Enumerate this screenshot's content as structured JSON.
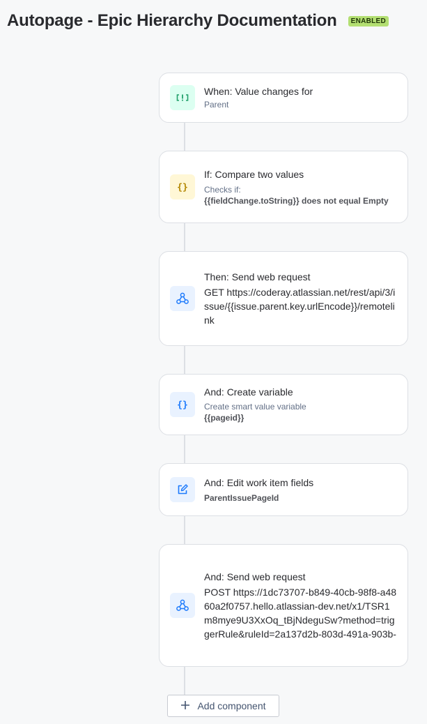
{
  "header": {
    "title": "Autopage - Epic Hierarchy Documentation",
    "status_badge": "ENABLED"
  },
  "components": [
    {
      "title": "When: Value changes for",
      "subtitle": "Parent",
      "icon": "trigger-icon"
    },
    {
      "title": "If: Compare two values",
      "subtitle": "Checks if:",
      "detail": "{{fieldChange.toString}} does not equal Empty",
      "icon": "braces-icon"
    },
    {
      "title": "Then: Send web request",
      "body": "GET https://coderay.atlassian.net/rest/api/3/issue/{{issue.parent.key.urlEncode}}/remotelink",
      "icon": "webhook-icon"
    },
    {
      "title": "And: Create variable",
      "subtitle": "Create smart value variable",
      "detail": "{{pageid}}",
      "icon": "braces-icon"
    },
    {
      "title": "And: Edit work item fields",
      "detail": "ParentIssuePageId",
      "icon": "edit-icon"
    },
    {
      "title": "And: Send web request",
      "body": "POST https://1dc73707-b849-40cb-98f8-a4860a2f0757.hello.atlassian-dev.net/x1/TSR1m8mye9U3XxOq_tBjNdeguSw?method=triggerRule&ruleId=2a137d2b-803d-491a-903b-",
      "icon": "webhook-icon"
    }
  ],
  "add_component": {
    "label": "Add component",
    "icon": "plus-icon"
  },
  "colors": {
    "background": "#f7f8f9",
    "badge_green": "#b3df72",
    "icon_blue": "#1d7afc",
    "icon_yellow": "#e2b203",
    "icon_green": "#22a06b"
  }
}
